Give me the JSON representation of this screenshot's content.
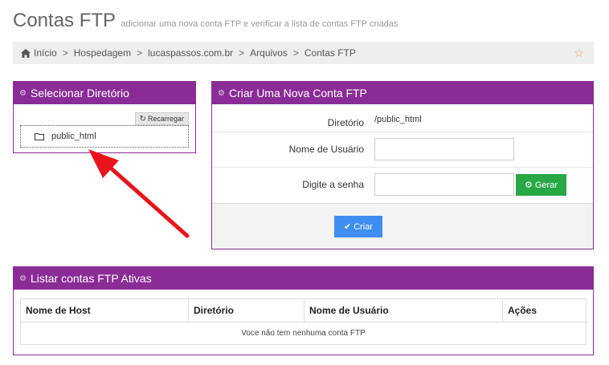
{
  "page": {
    "title": "Contas FTP",
    "subtitle": "adicionar uma nova conta FTP e verificar a lista de contas FTP criadas"
  },
  "breadcrumb": {
    "items": [
      "Início",
      "Hospedagem",
      "lucaspassos.com.br",
      "Arquivos",
      "Contas FTP"
    ],
    "separator": ">",
    "home_icon": "home-icon",
    "favorite_icon": "star-icon"
  },
  "directory_panel": {
    "title": "Selecionar Diretório",
    "reload_label": "Recarregar",
    "folder_name": "public_html"
  },
  "create_panel": {
    "title": "Criar Uma Nova Conta FTP",
    "directory_label": "Diretório",
    "directory_value": "/public_html",
    "username_label": "Nome de Usuário",
    "username_value": "",
    "password_label": "Digite a senha",
    "password_value": "",
    "generate_label": "Gerar",
    "create_label": "Criar"
  },
  "list_panel": {
    "title": "Listar contas FTP Ativas",
    "columns": [
      "Nome de Host",
      "Diretório",
      "Nome de Usuário",
      "Ações"
    ],
    "empty_message": "Voce não tem nenhuma conta FTP"
  },
  "colors": {
    "panel_header": "#8a2c96",
    "generate_button": "#28a745",
    "create_button": "#3d8ef0",
    "annotation_arrow": "#e8141b",
    "star": "#e8a23a"
  }
}
